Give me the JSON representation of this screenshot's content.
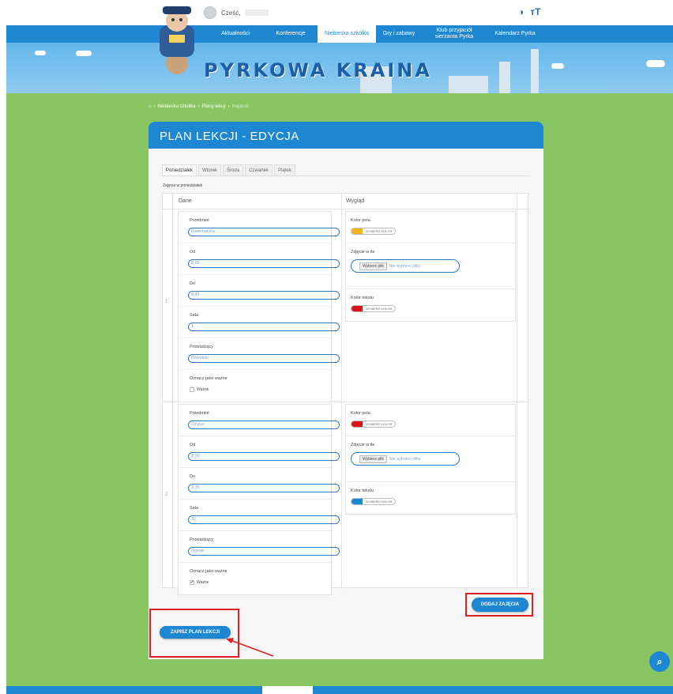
{
  "top": {
    "greeting": "Cześć,",
    "contrast_icon": "contrast-icon",
    "font_size_icon": "font-size-icon",
    "font_size_glyph": "тT"
  },
  "nav": {
    "items": [
      {
        "label": "Aktualności"
      },
      {
        "label": "Konferencje"
      },
      {
        "label": "Niebieska szkółka"
      },
      {
        "label": "Gry i zabawy"
      },
      {
        "label": "Klub przyjaciół sierżanta Pyrka"
      },
      {
        "label": "Kalendarz Pyrka"
      }
    ],
    "active_index": 2
  },
  "banner": {
    "title": "PYRKOWA KRAINA"
  },
  "breadcrumb": {
    "items": [
      "Niebieska szkółka",
      "Plany lekcji",
      "majacat"
    ]
  },
  "card": {
    "title": "PLAN LEKCJI - EDYCJA",
    "tabs": [
      "Poniedziałek",
      "Wtorek",
      "Środa",
      "Czwartek",
      "Piątek"
    ],
    "active_tab": "Poniedziałek",
    "section_label": "Zajęcia w poniedziałek",
    "col_data": "Dane",
    "col_look": "Wygląd",
    "labels": {
      "subject": "Przedmiot",
      "from": "Od",
      "to": "Do",
      "room": "Sala",
      "teacher": "Prowadzący",
      "important": "Oznacz jako ważne",
      "important_checkbox": "Ważne",
      "field_color": "Kolor pola",
      "bg_image": "Zdjęcie w tle",
      "text_color": "Kolor tekstu",
      "pick_color": "WYBIERZ KOLOR",
      "choose_file": "Wybierz plik",
      "no_file": "Nie wybrano pliku"
    },
    "lessons": [
      {
        "number": "1",
        "subject": "Matematyka",
        "from": "8:00",
        "to": "8:45",
        "room": "1",
        "teacher": "Kowalski",
        "important": false,
        "field_color": "#f0b41e",
        "text_color": "#d9131c"
      },
      {
        "number": "2",
        "subject": "Fizyka",
        "from": "8:50",
        "to": "9:35",
        "room": "32",
        "teacher": "Nowak",
        "important": true,
        "field_color": "#d9131c",
        "text_color": "#1e87d2"
      }
    ],
    "add_button": "DODAJ ZAJĘCIA",
    "save_button": "ZAPISZ PLAN LEKCJI"
  },
  "colors": {
    "primary": "#1e87d2",
    "green": "#89c661",
    "highlight": "#e02020"
  }
}
